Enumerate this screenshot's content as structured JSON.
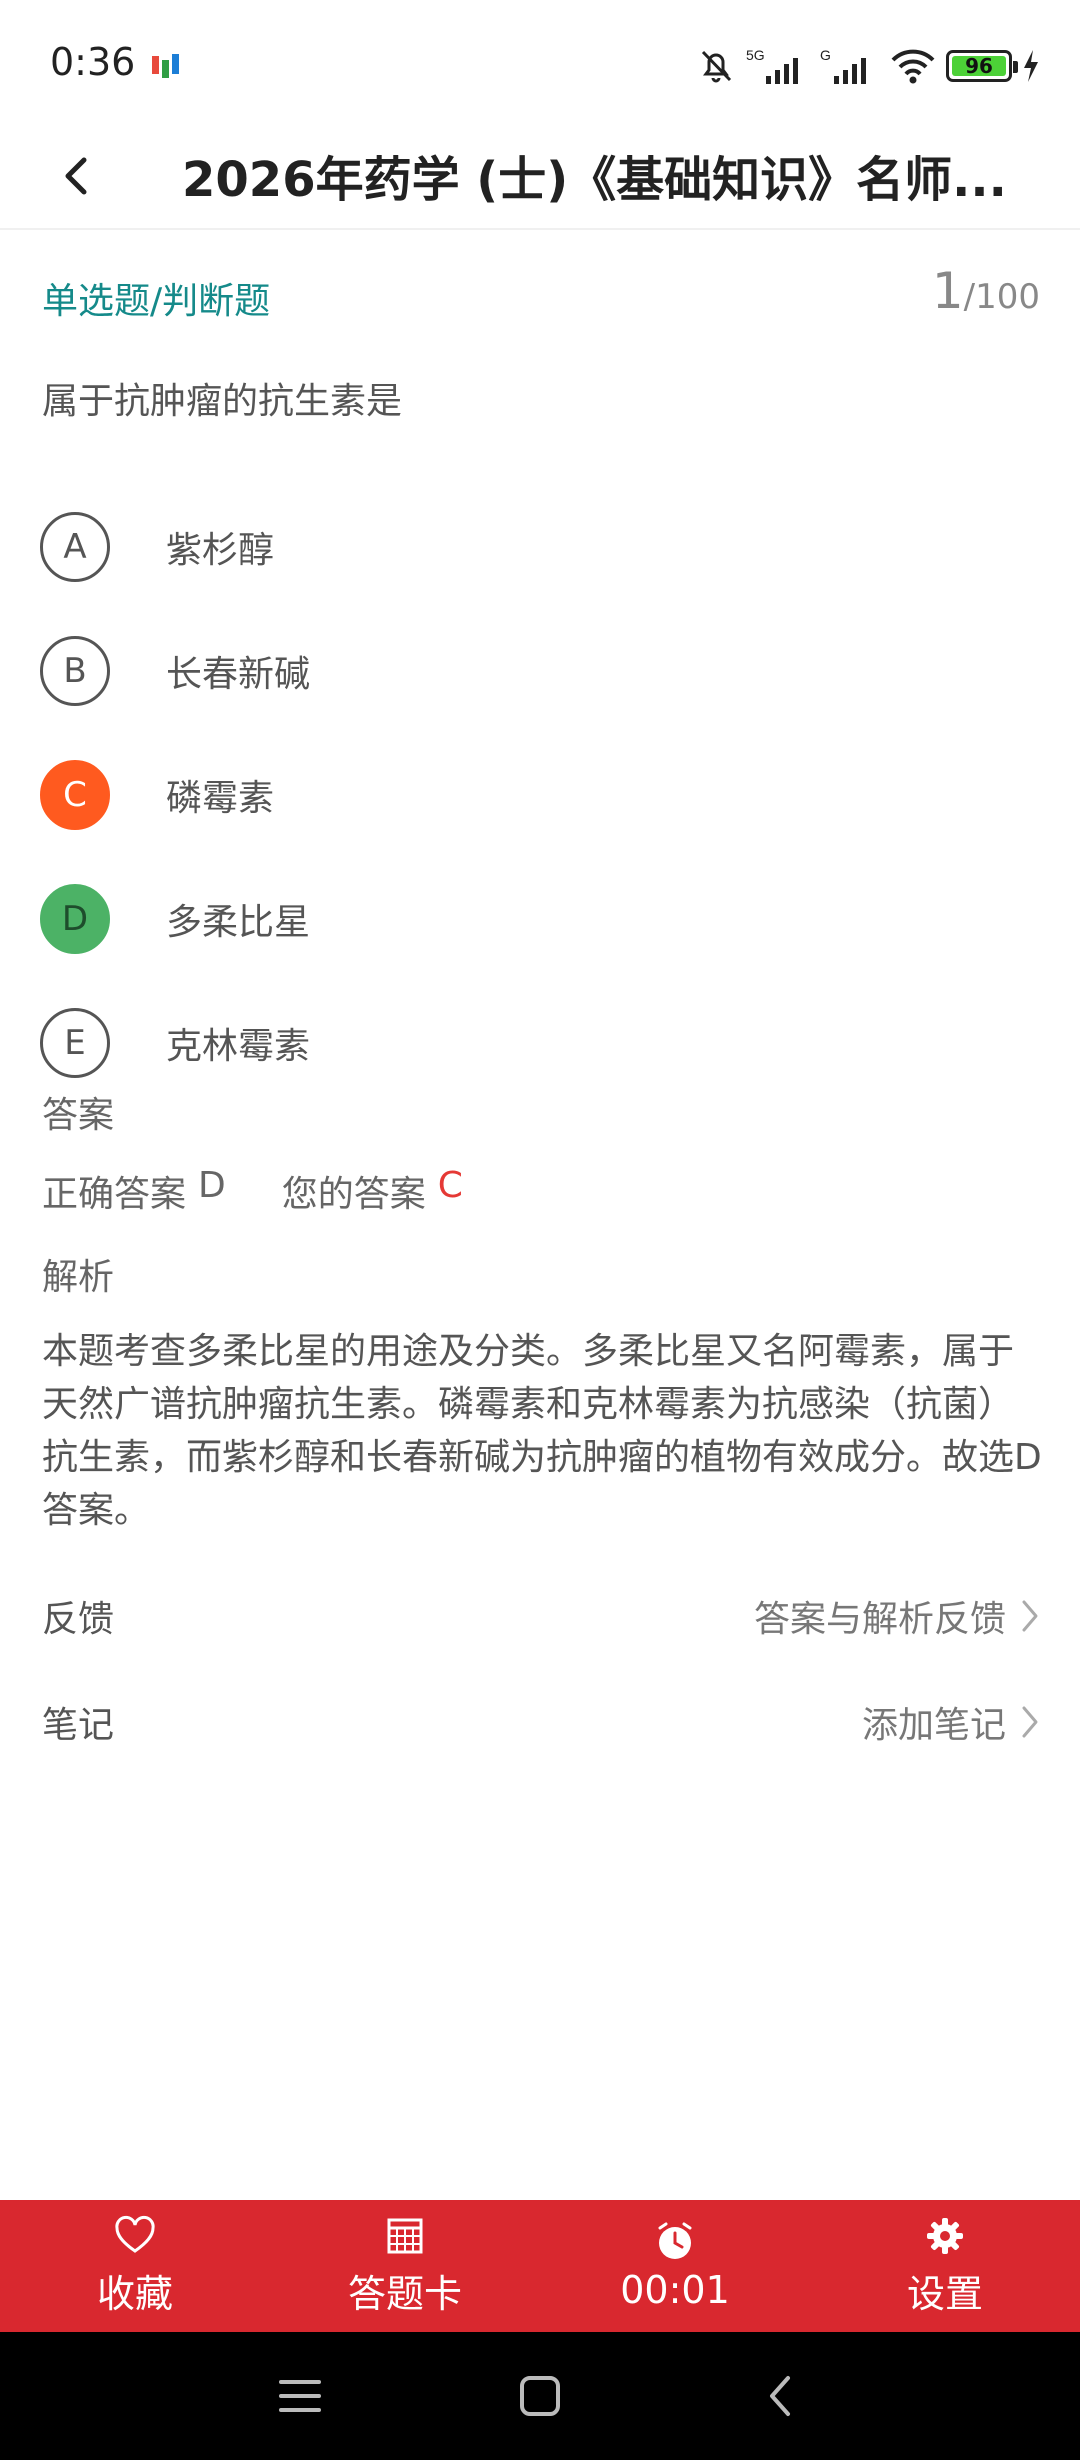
{
  "status_bar": {
    "time": "0:36",
    "battery_level": "96",
    "network_labels": [
      "5G",
      "G"
    ],
    "icons": [
      "app-notification-icon",
      "bell-muted-icon",
      "signal-5g-icon",
      "signal-g-icon",
      "wifi-icon",
      "battery-icon",
      "charging-icon"
    ],
    "battery_color": "#4cd137"
  },
  "header": {
    "title": "2026年药学 (士)《基础知识》名师..."
  },
  "question": {
    "type_label": "单选题/判断题",
    "current": "1",
    "total": "/100",
    "text": "属于抗肿瘤的抗生素是",
    "options": [
      {
        "letter": "A",
        "text": "紫杉醇",
        "state": "normal"
      },
      {
        "letter": "B",
        "text": "长春新碱",
        "state": "normal"
      },
      {
        "letter": "C",
        "text": "磷霉素",
        "state": "wrong"
      },
      {
        "letter": "D",
        "text": "多柔比星",
        "state": "correct"
      },
      {
        "letter": "E",
        "text": "克林霉素",
        "state": "normal"
      }
    ]
  },
  "answer": {
    "title": "答案",
    "correct_label": "正确答案",
    "correct_value": "D",
    "user_label": "您的答案",
    "user_value": "C"
  },
  "analysis": {
    "title": "解析",
    "text": "本题考查多柔比星的用途及分类。多柔比星又名阿霉素，属于天然广谱抗肿瘤抗生素。磷霉素和克林霉素为抗感染（抗菌）抗生素，而紫杉醇和长春新碱为抗肿瘤的植物有效成分。故选D答案。"
  },
  "feedback": {
    "label": "反馈",
    "action": "答案与解析反馈"
  },
  "notes": {
    "label": "笔记",
    "action": "添加笔记"
  },
  "toolbar": {
    "favorite": "收藏",
    "answer_card": "答题卡",
    "timer": "00:01",
    "settings": "设置"
  },
  "colors": {
    "accent_red": "#d9282f",
    "type_teal": "#158a8a",
    "wrong_orange": "#ff5a1f",
    "correct_green": "#4cb266"
  }
}
